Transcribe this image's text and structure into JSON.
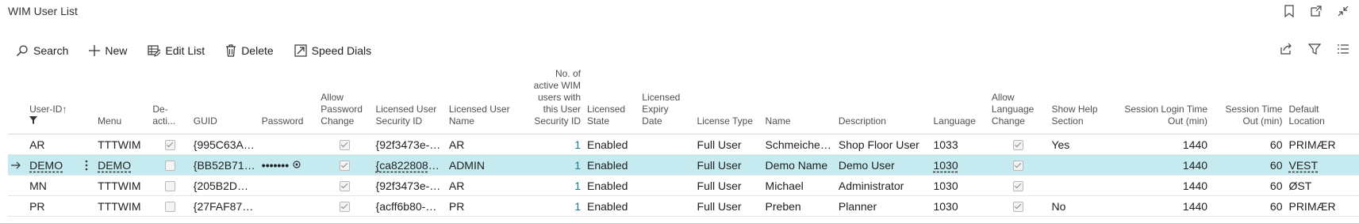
{
  "page": {
    "title": "WIM User List"
  },
  "toolbar": {
    "search": "Search",
    "new": "New",
    "edit_list": "Edit List",
    "delete": "Delete",
    "speed_dials": "Speed Dials"
  },
  "columns": {
    "user_id": "User-ID",
    "sort_arrow": "↑",
    "menu": "Menu",
    "deactivated": "De-acti...",
    "guid": "GUID",
    "password": "Password",
    "allow_password_change": "Allow Password Change",
    "licensed_user_security_id": "Licensed User Security ID",
    "licensed_user_name": "Licensed User Name",
    "active_wim_users": "No. of active WIM users with this User Security ID",
    "licensed_state": "Licensed State",
    "licensed_expiry_date": "Licensed Expiry Date",
    "license_type": "License Type",
    "name": "Name",
    "description": "Description",
    "language": "Language",
    "allow_language_change": "Allow Language Change",
    "show_help_section": "Show Help Section",
    "session_login_time_out": "Session Login Time Out (min)",
    "session_time_out": "Session Time Out (min)",
    "default_location": "Default Location"
  },
  "rows": [
    {
      "user_id": "AR",
      "menu": "TTTWIM",
      "deactivated": true,
      "guid": "{995C63AF-...",
      "password": "",
      "allow_password_change": true,
      "security_id": "{92f3473e-7...",
      "licensed_user_name": "AR",
      "active_users": "1",
      "licensed_state": "Enabled",
      "expiry_date": "",
      "license_type": "Full User",
      "name": "Schmeichel ...",
      "description": "Shop Floor User",
      "language": "1033",
      "allow_language_change": true,
      "show_help": "Yes",
      "login_timeout": "1440",
      "session_timeout": "60",
      "location": "PRIMÆR"
    },
    {
      "user_id": "DEMO",
      "menu": "DEMO",
      "deactivated": false,
      "guid": "{BB52B71B-...",
      "password": "•••••••",
      "allow_password_change": true,
      "security_id": "{ca822808-4...",
      "licensed_user_name": "ADMIN",
      "active_users": "1",
      "licensed_state": "Enabled",
      "expiry_date": "",
      "license_type": "Full User",
      "name": "Demo Name",
      "description": "Demo User",
      "language": "1030",
      "allow_language_change": true,
      "show_help": "",
      "login_timeout": "1440",
      "session_timeout": "60",
      "location": "VEST"
    },
    {
      "user_id": "MN",
      "menu": "TTTWIM",
      "deactivated": false,
      "guid": "{205B2DC1...",
      "password": "",
      "allow_password_change": true,
      "security_id": "{92f3473e-7...",
      "licensed_user_name": "AR",
      "active_users": "1",
      "licensed_state": "Enabled",
      "expiry_date": "",
      "license_type": "Full User",
      "name": "Michael",
      "description": "Administrator",
      "language": "1030",
      "allow_language_change": true,
      "show_help": "",
      "login_timeout": "1440",
      "session_timeout": "60",
      "location": "ØST"
    },
    {
      "user_id": "PR",
      "menu": "TTTWIM",
      "deactivated": false,
      "guid": "{27FAF870-...",
      "password": "",
      "allow_password_change": true,
      "security_id": "{acff6b80-0e...",
      "licensed_user_name": "PR",
      "active_users": "1",
      "licensed_state": "Enabled",
      "expiry_date": "",
      "license_type": "Full User",
      "name": "Preben",
      "description": "Planner",
      "language": "1030",
      "allow_language_change": true,
      "show_help": "No",
      "login_timeout": "1440",
      "session_timeout": "60",
      "location": "PRIMÆR"
    }
  ],
  "selected_row": 1,
  "colors": {
    "selected_row": "#c5eaf0",
    "link": "#1b7a94",
    "text": "#212121"
  },
  "icons": [
    "bookmark-icon",
    "open-new-window-icon",
    "collapse-icon",
    "search-icon",
    "plus-icon",
    "edit-list-icon",
    "trash-icon",
    "speed-dials-icon",
    "share-icon",
    "filter-icon",
    "list-view-icon",
    "row-arrow-icon",
    "row-menu-icon"
  ]
}
